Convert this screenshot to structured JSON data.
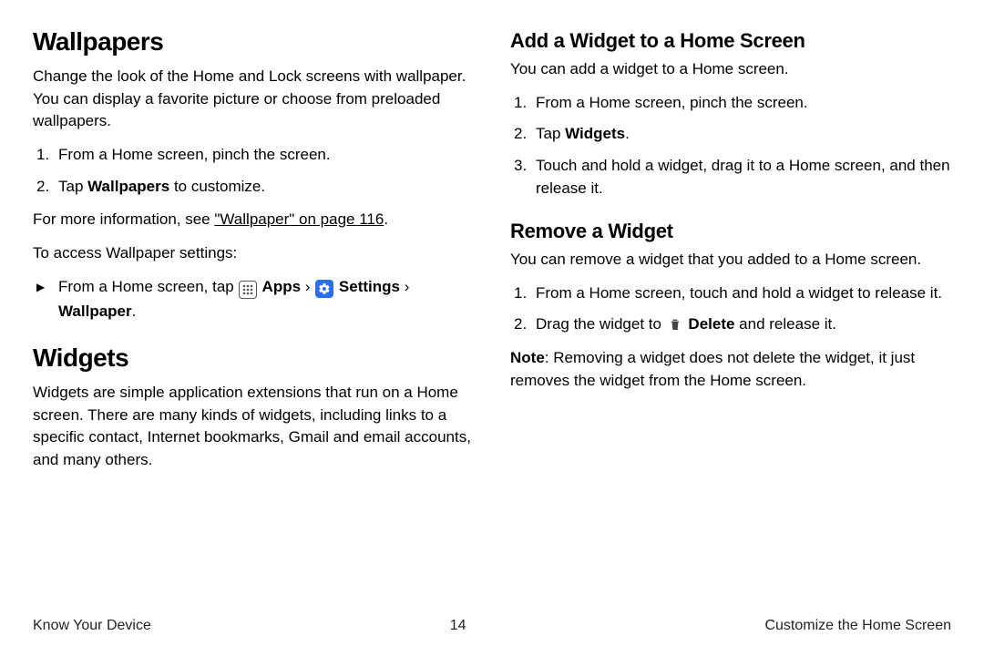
{
  "left": {
    "wallpapers": {
      "heading": "Wallpapers",
      "intro": "Change the look of the Home and Lock screens with wallpaper. You can display a favorite picture or choose from preloaded wallpapers.",
      "step1": "From a Home screen, pinch the screen.",
      "step2_pre": "Tap ",
      "step2_bold": "Wallpapers",
      "step2_post": " to customize.",
      "more_pre": "For more information, see ",
      "more_link": "\"Wallpaper\" on page 116",
      "more_post": ".",
      "access": "To access Wallpaper settings:",
      "path_pre": "From a Home screen, tap ",
      "path_apps": " Apps ",
      "path_settings": " Settings",
      "path_wall": "Wallpaper",
      "path_dot": "."
    },
    "widgets": {
      "heading": "Widgets",
      "intro": "Widgets are simple application extensions that run on a Home screen. There are many kinds of widgets, including links to a specific contact, Internet bookmarks, Gmail and email accounts, and many others."
    }
  },
  "right": {
    "add": {
      "heading": "Add a Widget to a Home Screen",
      "intro": "You can add a widget to a Home screen.",
      "step1": "From a Home screen, pinch the screen.",
      "step2_pre": "Tap ",
      "step2_bold": "Widgets",
      "step2_post": ".",
      "step3": "Touch and hold a widget, drag it to a Home screen, and then release it."
    },
    "remove": {
      "heading": "Remove a Widget",
      "intro": "You can remove a widget that you added to a Home screen.",
      "step1": "From a Home screen, touch and hold a widget to release it.",
      "step2_pre": "Drag the widget to ",
      "step2_bold": " Delete",
      "step2_post": " and release it.",
      "note_label": "Note",
      "note_body": ": Removing a widget does not delete the widget, it just removes the widget from the Home screen."
    }
  },
  "footer": {
    "left": "Know Your Device",
    "center": "14",
    "right": "Customize the Home Screen"
  },
  "chevron": " › "
}
